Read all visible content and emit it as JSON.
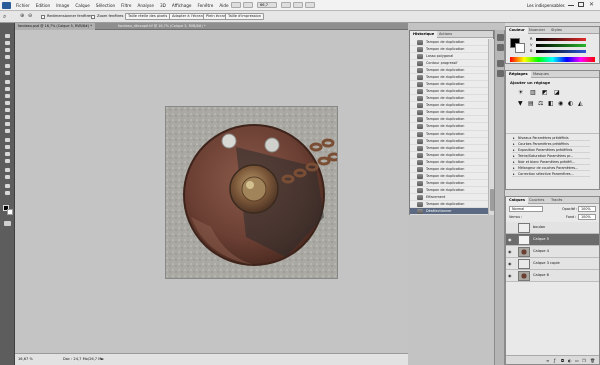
{
  "menubar": {
    "items": [
      "Fichier",
      "Edition",
      "Image",
      "Calque",
      "Sélection",
      "Filtre",
      "Analyse",
      "3D",
      "Affichage",
      "Fenêtre",
      "Aide"
    ],
    "zoom": "66,7",
    "workspace": "Les indispensables"
  },
  "optionsbar": {
    "resize_windows": "Redimensionner fenêtres",
    "zoom_all": "Zoom fenêtres",
    "actual_pixels": "Taille réelle des pixels",
    "fit_screen": "Adapter à l'écran",
    "fill_screen": "Plein écran",
    "print_size": "Taille d'impression"
  },
  "document_tabs": [
    {
      "label": "fondeau.psd @ 16,7% (Calque 5, RVB/8#) *",
      "active": true
    },
    {
      "label": "fondeau_découpé.tif @ 16,7% (Calque 3, RVB/8#) *",
      "active": false
    }
  ],
  "history": {
    "tabs": [
      "Historique",
      "Actions"
    ],
    "items": [
      "Tampon de duplication",
      "Tampon de duplication",
      "Lasso polygonal",
      "Contour progressif",
      "Tampon de duplication",
      "Tampon de duplication",
      "Tampon de duplication",
      "Tampon de duplication",
      "Tampon de duplication",
      "Tampon de duplication",
      "Tampon de duplication",
      "Tampon de duplication",
      "Tampon de duplication",
      "Tampon de duplication",
      "Tampon de duplication",
      "Tampon de duplication",
      "Tampon de duplication",
      "Tampon de duplication",
      "Tampon de duplication",
      "Tampon de duplication",
      "Tampon de duplication",
      "Tampon de duplication",
      "Effacement",
      "Tampon de duplication",
      "Désélectionner"
    ],
    "active_index": 24
  },
  "color_panel": {
    "tabs": [
      "Couleur",
      "Nuancier",
      "Styles"
    ],
    "labels": [
      "R",
      "V",
      "B"
    ],
    "colors": {
      "red": "#e02b2b",
      "green": "#2bb52b",
      "blue": "#2b57d8"
    }
  },
  "adjustments": {
    "tabs": [
      "Réglages",
      "Masques"
    ],
    "heading": "Ajouter un réglage",
    "presets": [
      "Niveaux Paramètres prédéfinis",
      "Courbes Paramètres prédéfinis",
      "Exposition Paramètres prédéfinis",
      "Teinte/Saturation Paramètres pr...",
      "Noir et blanc Paramètres prédéfi...",
      "Mélangeur de couches Paramètres...",
      "Correction sélective Paramètres..."
    ]
  },
  "layers": {
    "tabs": [
      "Calques",
      "Couches",
      "Tracés"
    ],
    "blend_mode": "Normal",
    "opacity_label": "Opacité :",
    "opacity_value": "100%",
    "lock_label": "Verrou :",
    "fill_label": "Fond :",
    "fill_value": "100%",
    "items": [
      {
        "name": "boulon",
        "active": false
      },
      {
        "name": "Calque 5",
        "active": true
      },
      {
        "name": "Calque 4",
        "active": false
      },
      {
        "name": "Calque 3 copie",
        "active": false
      },
      {
        "name": "Calque 6",
        "active": false
      }
    ]
  },
  "status": {
    "zoom": "16,67 %",
    "doc": "Doc : 24,7 Mo/26,7 Mo"
  },
  "colors": {
    "ui_dark": "#5d5d5d",
    "selection": "#5b6a82",
    "canvas_bg": "#c4c4c4"
  },
  "icons": [
    "zoom-icon",
    "selection-icon",
    "lasso-icon",
    "crop-icon",
    "brush-icon",
    "stamp-icon",
    "eraser-icon",
    "eye-icon",
    "history-brush-icon"
  ]
}
